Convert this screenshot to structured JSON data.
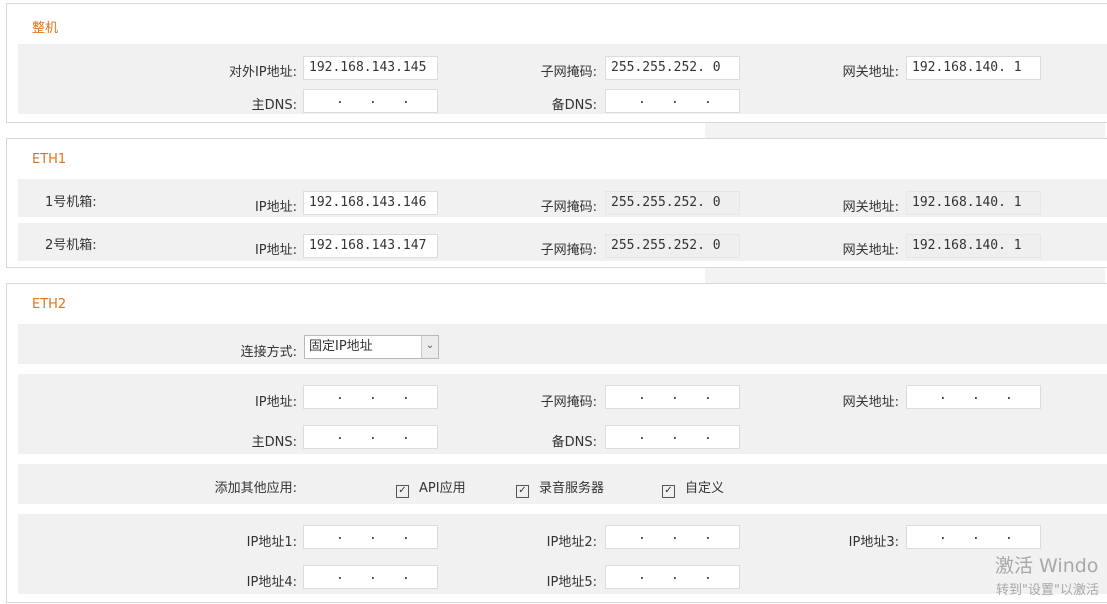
{
  "whole": {
    "title": "整机",
    "external_ip_label": "对外IP地址:",
    "external_ip": "192.168.143.145",
    "subnet_label": "子网掩码:",
    "subnet": "255.255.252. 0",
    "gateway_label": "网关地址:",
    "gateway": "192.168.140. 1",
    "dns1_label": "主DNS:",
    "dns2_label": "备DNS:"
  },
  "eth1": {
    "title": "ETH1",
    "rows": [
      {
        "name": "1号机箱:",
        "ip_label": "IP地址:",
        "ip": "192.168.143.146",
        "subnet_label": "子网掩码:",
        "subnet": "255.255.252. 0",
        "gateway_label": "网关地址:",
        "gateway": "192.168.140. 1"
      },
      {
        "name": "2号机箱:",
        "ip_label": "IP地址:",
        "ip": "192.168.143.147",
        "subnet_label": "子网掩码:",
        "subnet": "255.255.252. 0",
        "gateway_label": "网关地址:",
        "gateway": "192.168.140. 1"
      }
    ]
  },
  "eth2": {
    "title": "ETH2",
    "mode_label": "连接方式:",
    "mode_value": "固定IP地址",
    "ip_label": "IP地址:",
    "subnet_label": "子网掩码:",
    "gateway_label": "网关地址:",
    "dns1_label": "主DNS:",
    "dns2_label": "备DNS:",
    "apps_label": "添加其他应用:",
    "apps": [
      "API应用",
      "录音服务器",
      "自定义"
    ],
    "extra_ip_labels": [
      "IP地址1:",
      "IP地址2:",
      "IP地址3:",
      "IP地址4:",
      "IP地址5:"
    ]
  },
  "watermark": {
    "line1": "激活 Windo",
    "line2": "转到\"设置\"以激活"
  }
}
